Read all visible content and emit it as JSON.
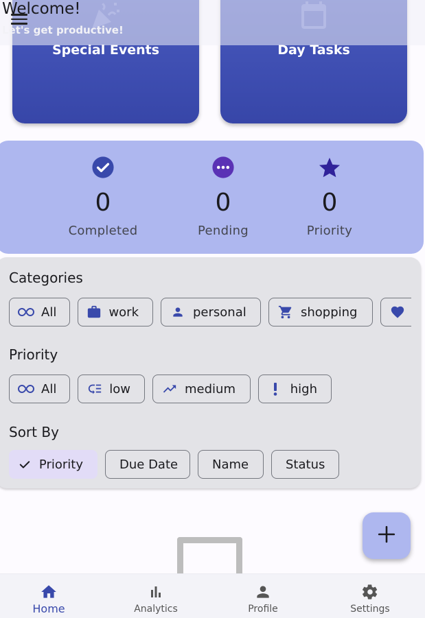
{
  "header": {
    "welcome": "Welcome!",
    "subtitle": "Let's get productive!"
  },
  "event_cards": [
    {
      "label": "Special Events",
      "icon": "celebration-icon"
    },
    {
      "label": "Day Tasks",
      "icon": "calendar-icon"
    }
  ],
  "stats": [
    {
      "value": "0",
      "label": "Completed",
      "icon": "check-circle-icon",
      "color": "#3949ab"
    },
    {
      "value": "0",
      "label": "Pending",
      "icon": "more-horiz-circle-icon",
      "color": "#5a32b5"
    },
    {
      "value": "0",
      "label": "Priority",
      "icon": "star-icon",
      "color": "#30229a"
    }
  ],
  "categories": {
    "title": "Categories",
    "chips": [
      {
        "label": "All",
        "icon": "infinity-icon"
      },
      {
        "label": "work",
        "icon": "briefcase-icon"
      },
      {
        "label": "personal",
        "icon": "person-icon"
      },
      {
        "label": "shopping",
        "icon": "cart-icon"
      },
      {
        "label": "",
        "icon": "heart-icon"
      }
    ]
  },
  "priority": {
    "title": "Priority",
    "chips": [
      {
        "label": "All",
        "icon": "infinity-icon"
      },
      {
        "label": "low",
        "icon": "low-priority-icon"
      },
      {
        "label": "medium",
        "icon": "trending-up-icon"
      },
      {
        "label": "high",
        "icon": "exclamation-icon"
      }
    ]
  },
  "sort": {
    "title": "Sort By",
    "options": [
      {
        "label": "Priority",
        "selected": true
      },
      {
        "label": "Due Date",
        "selected": false
      },
      {
        "label": "Name",
        "selected": false
      },
      {
        "label": "Status",
        "selected": false
      }
    ]
  },
  "bottom_nav": [
    {
      "label": "Home",
      "icon": "home-icon",
      "active": true
    },
    {
      "label": "Analytics",
      "icon": "bar-chart-icon",
      "active": false
    },
    {
      "label": "Profile",
      "icon": "person-icon",
      "active": false
    },
    {
      "label": "Settings",
      "icon": "gear-icon",
      "active": false
    }
  ],
  "colors": {
    "accent": "#3949ab",
    "stats_panel": "#aeb7ef",
    "filter_panel": "#e3e3e7",
    "selected_chip": "#e2dcf7"
  }
}
